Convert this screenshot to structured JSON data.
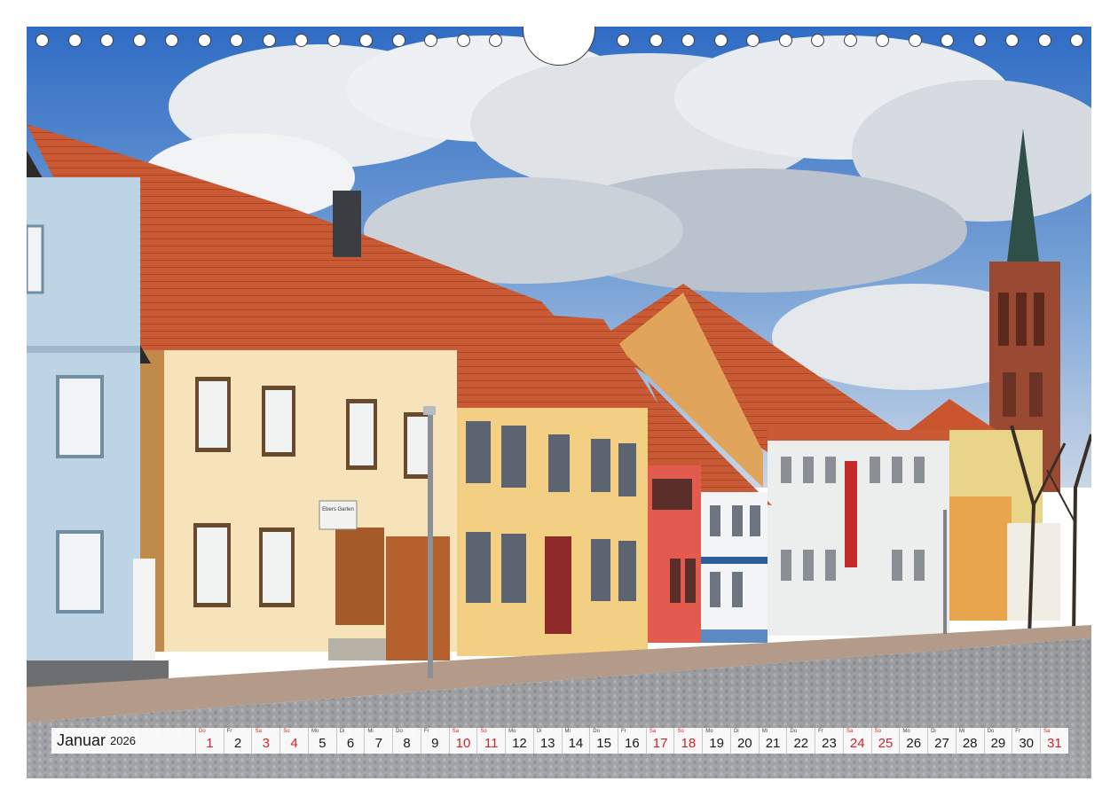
{
  "calendar": {
    "month": "Januar",
    "year": "2026",
    "days": [
      {
        "wd": "Do",
        "n": "1",
        "red": true
      },
      {
        "wd": "Fr",
        "n": "2",
        "red": false
      },
      {
        "wd": "Sa",
        "n": "3",
        "red": true
      },
      {
        "wd": "So",
        "n": "4",
        "red": true
      },
      {
        "wd": "Mo",
        "n": "5",
        "red": false
      },
      {
        "wd": "Di",
        "n": "6",
        "red": false
      },
      {
        "wd": "Mi",
        "n": "7",
        "red": false
      },
      {
        "wd": "Do",
        "n": "8",
        "red": false
      },
      {
        "wd": "Fr",
        "n": "9",
        "red": false
      },
      {
        "wd": "Sa",
        "n": "10",
        "red": true
      },
      {
        "wd": "So",
        "n": "11",
        "red": true
      },
      {
        "wd": "Mo",
        "n": "12",
        "red": false
      },
      {
        "wd": "Di",
        "n": "13",
        "red": false
      },
      {
        "wd": "Mi",
        "n": "14",
        "red": false
      },
      {
        "wd": "Do",
        "n": "15",
        "red": false
      },
      {
        "wd": "Fr",
        "n": "16",
        "red": false
      },
      {
        "wd": "Sa",
        "n": "17",
        "red": true
      },
      {
        "wd": "So",
        "n": "18",
        "red": true
      },
      {
        "wd": "Mo",
        "n": "19",
        "red": false
      },
      {
        "wd": "Di",
        "n": "20",
        "red": false
      },
      {
        "wd": "Mi",
        "n": "21",
        "red": false
      },
      {
        "wd": "Do",
        "n": "22",
        "red": false
      },
      {
        "wd": "Fr",
        "n": "23",
        "red": false
      },
      {
        "wd": "Sa",
        "n": "24",
        "red": true
      },
      {
        "wd": "So",
        "n": "25",
        "red": true
      },
      {
        "wd": "Mo",
        "n": "26",
        "red": false
      },
      {
        "wd": "Di",
        "n": "27",
        "red": false
      },
      {
        "wd": "Mi",
        "n": "28",
        "red": false
      },
      {
        "wd": "Do",
        "n": "29",
        "red": false
      },
      {
        "wd": "Fr",
        "n": "30",
        "red": false
      },
      {
        "wd": "Sa",
        "n": "31",
        "red": true
      }
    ]
  },
  "photo": {
    "sign_text": "Ebers Garten",
    "sky_color": "#3f78c8",
    "roof_color": "#c9552e",
    "church_color": "#9a4a32"
  }
}
